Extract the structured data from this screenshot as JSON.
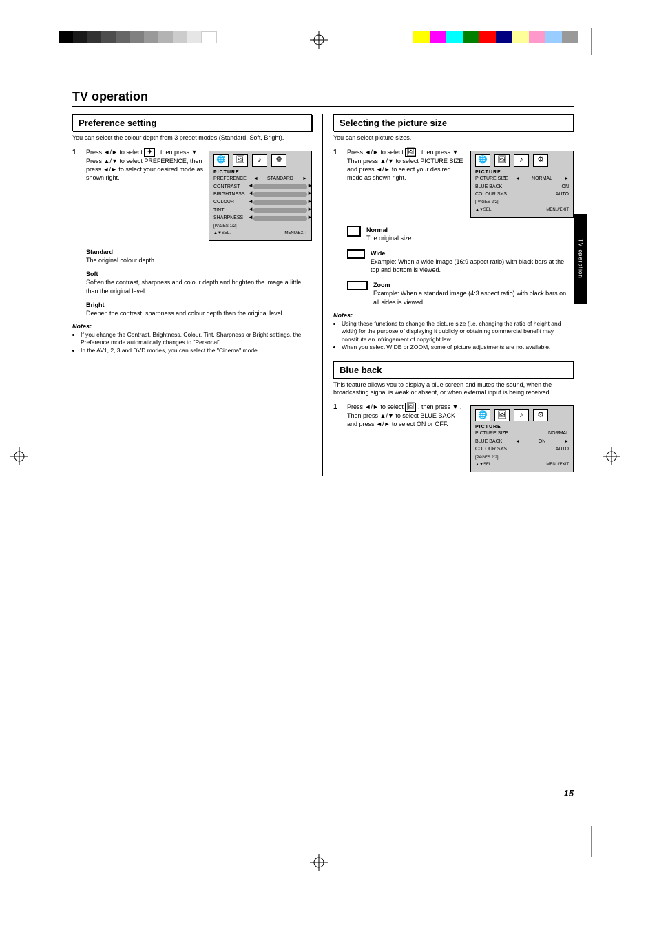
{
  "page": {
    "title": "TV operation",
    "number": "15",
    "side_tab": "TV operation"
  },
  "regmarks": {
    "top": "top-center",
    "bottom": "bottom-center",
    "left": "left-center",
    "right": "right-center"
  },
  "colorbar_left": [
    "#000000",
    "#1a1a1a",
    "#333333",
    "#4d4d4d",
    "#666666",
    "#808080",
    "#999999",
    "#b3b3b3",
    "#cccccc",
    "#e6e6e6",
    "#ffffff"
  ],
  "colorbar_right": [
    "#ffff00",
    "#ff00ff",
    "#00ffff",
    "#008000",
    "#ff0000",
    "#000080",
    "#ffff99",
    "#ff99cc",
    "#99ccff",
    "#999999"
  ],
  "left_col": {
    "section_title": "Preference setting",
    "intro": "You can select the colour depth from 3 preset modes (Standard, Soft, Bright).",
    "step1": {
      "a": "Press ",
      "b1": "◄",
      "b2": "►",
      "c": " to select ",
      "d_icon": "preference-icon",
      "e": ", then press ",
      "f1": "▼",
      "g": ". Press ",
      "h1": "▲",
      "h2": "▼",
      "i": " to select PREFERENCE, then press ",
      "j1": "◄",
      "j2": "►",
      "k": " to select your desired mode as shown right."
    },
    "osd": {
      "title": "PICTURE",
      "rows": [
        {
          "label": "PREFERENCE",
          "value": "STANDARD",
          "type": "select"
        },
        {
          "label": "CONTRAST",
          "type": "slider"
        },
        {
          "label": "BRIGHTNESS",
          "type": "slider"
        },
        {
          "label": "COLOUR",
          "type": "slider"
        },
        {
          "label": "TINT",
          "type": "slider"
        },
        {
          "label": "SHARPNESS",
          "type": "slider"
        }
      ],
      "pages": "[PAGES 1/2]",
      "footer_left": "▲▼SEL.",
      "footer_right": "MENU/EXIT"
    },
    "standard": {
      "label": "Standard",
      "desc": "The original colour depth."
    },
    "soft": {
      "label": "Soft",
      "desc": "Soften the contrast, sharpness and colour depth and brighten the image a little than the original level."
    },
    "bright": {
      "label": "Bright",
      "desc": "Deepen the contrast, sharpness and colour depth than the original level."
    },
    "notes_head": "Notes:",
    "notes": [
      "If you change the Contrast, Brightness, Colour, Tint, Sharpness or Bright settings, the Preference mode automatically changes to \"Personal\".",
      "In the AV1, 2, 3 and DVD modes, you can select the \"Cinema\" mode."
    ]
  },
  "right_col": {
    "section1_title": "Selecting the picture size",
    "intro1": "You can select picture sizes.",
    "step1": {
      "a": "Press ",
      "b1": "◄",
      "b2": "►",
      "c": " to select ",
      "icon": "picture-icon",
      "d": ", then press ",
      "e": "▼",
      "f": ". Then press ",
      "g1": "▲",
      "g2": "▼",
      "h": " to select PICTURE SIZE and press ",
      "i1": "◄",
      "i2": "►",
      "j": " to select your desired mode as shown right."
    },
    "osd1": {
      "title": "PICTURE",
      "rows": [
        {
          "label": "PICTURE SIZE",
          "value": "NORMAL",
          "type": "select"
        },
        {
          "label": "BLUE BACK",
          "value": "ON",
          "type": "value"
        },
        {
          "label": "COLOUR SYS.",
          "value": "AUTO",
          "type": "value"
        }
      ],
      "pages": "[PAGES 2/2]",
      "footer_left": "▲▼SEL.",
      "footer_right": "MENU/EXIT"
    },
    "normal": {
      "icon": "□",
      "label": "Normal",
      "desc": "The original size."
    },
    "wide": {
      "icon": "▭",
      "label": "Wide",
      "desc": "Example: When a wide image (16:9 aspect ratio) with black bars at the top and bottom is viewed."
    },
    "zoom": {
      "icon": "▭",
      "label": "Zoom",
      "desc": "Example: When a standard image (4:3 aspect ratio) with black bars on all sides is viewed."
    },
    "notes_head": "Notes:",
    "notes": [
      "Using these functions to change the picture size (i.e. changing the ratio of height and width) for the purpose of displaying it publicly or obtaining commercial benefit may constitute an infringement of copyright law.",
      "When you select WIDE or ZOOM, some of picture adjustments are not available."
    ],
    "section2_title": "Blue back",
    "intro2": "This feature allows you to display a blue screen and mutes the sound, when the broadcasting signal is weak or absent, or when external input is being received.",
    "step2": {
      "a": "Press ",
      "b1": "◄",
      "b2": "►",
      "c": " to select ",
      "icon": "picture-icon",
      "d": ", then press ",
      "e": "▼",
      "f": ". Then press ",
      "g1": "▲",
      "g2": "▼",
      "h": " to select BLUE BACK and press ",
      "i1": "◄",
      "i2": "►",
      "j": " to select ON or OFF."
    },
    "osd2": {
      "title": "PICTURE",
      "rows": [
        {
          "label": "PICTURE SIZE",
          "value": "NORMAL",
          "type": "value"
        },
        {
          "label": "BLUE BACK",
          "value": "ON",
          "type": "select"
        },
        {
          "label": "COLOUR SYS.",
          "value": "AUTO",
          "type": "value"
        }
      ],
      "pages": "[PAGES 2/2]",
      "footer_left": "▲▼SEL.",
      "footer_right": "MENU/EXIT"
    }
  }
}
